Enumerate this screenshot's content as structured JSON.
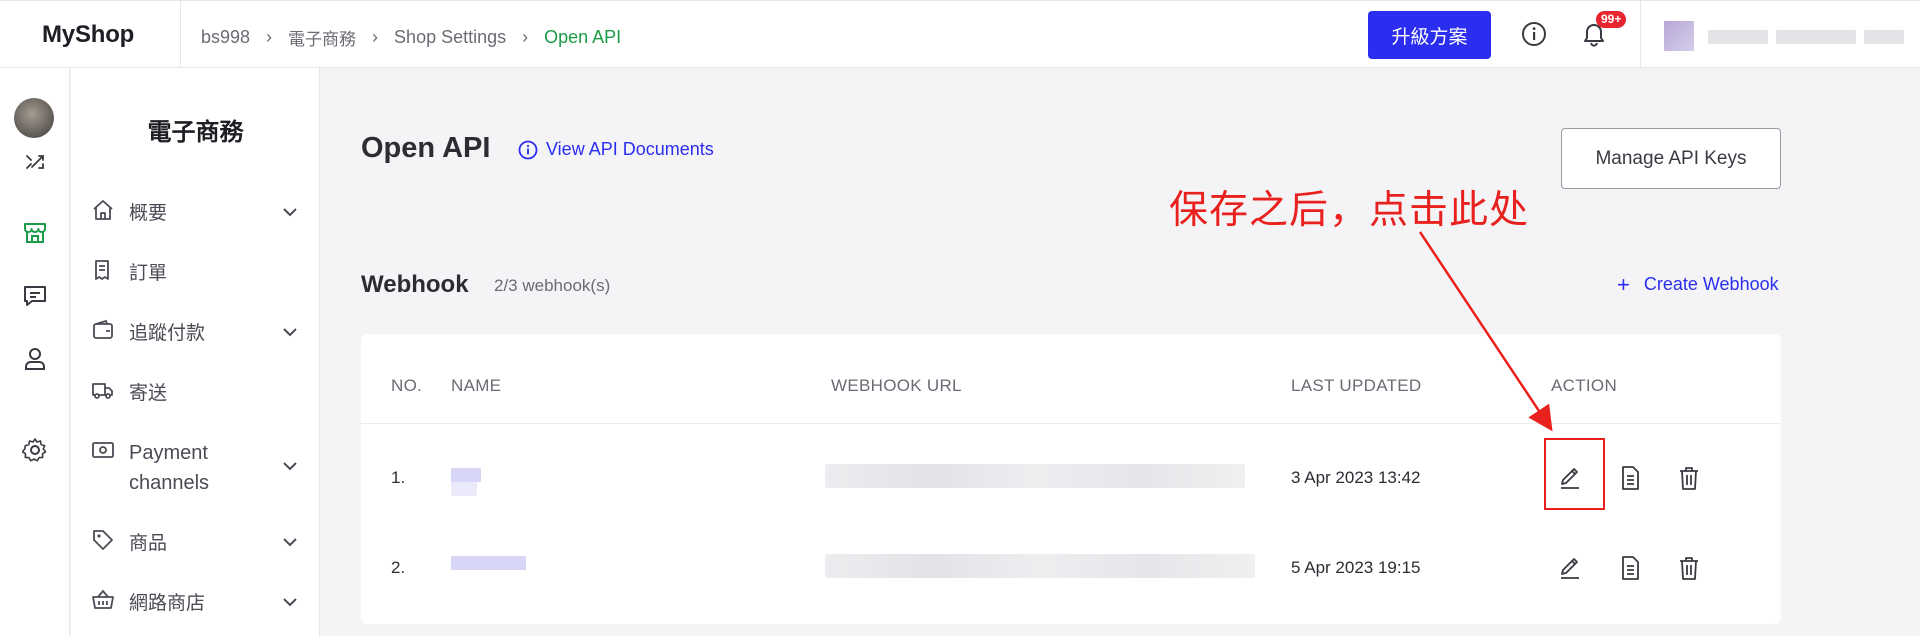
{
  "topbar": {
    "logo": "MyShop",
    "breadcrumb": [
      "bs998",
      "電子商務",
      "Shop Settings",
      "Open API"
    ],
    "upgrade_label": "升級方案",
    "notifications_badge": "99+"
  },
  "sidebar": {
    "title": "電子商務",
    "items": [
      {
        "label": "概要",
        "icon": "home-icon",
        "has_children": true
      },
      {
        "label": "訂單",
        "icon": "receipt-icon",
        "has_children": false
      },
      {
        "label": "追蹤付款",
        "icon": "wallet-icon",
        "has_children": true
      },
      {
        "label": "寄送",
        "icon": "truck-icon",
        "has_children": false
      },
      {
        "label": "Payment channels",
        "icon": "cash-icon",
        "has_children": true
      },
      {
        "label": "商品",
        "icon": "tag-icon",
        "has_children": true
      },
      {
        "label": "網路商店",
        "icon": "basket-icon",
        "has_children": true
      }
    ]
  },
  "main": {
    "title": "Open API",
    "doc_link": "View API Documents",
    "manage_keys_label": "Manage API Keys",
    "annotation": "保存之后，点击此处",
    "webhook": {
      "title": "Webhook",
      "count": "2/3 webhook(s)",
      "create_label": "Create Webhook",
      "columns": [
        "NO.",
        "NAME",
        "WEBHOOK URL",
        "LAST UPDATED",
        "ACTION"
      ],
      "rows": [
        {
          "no": "1.",
          "last_updated": "3 Apr 2023 13:42"
        },
        {
          "no": "2.",
          "last_updated": "5 Apr 2023 19:15"
        }
      ]
    }
  },
  "colors": {
    "accent": "#2b2ef0",
    "breadcrumb_current": "#1a9b47",
    "annotation": "#e8211e",
    "badge": "#e8252f"
  }
}
